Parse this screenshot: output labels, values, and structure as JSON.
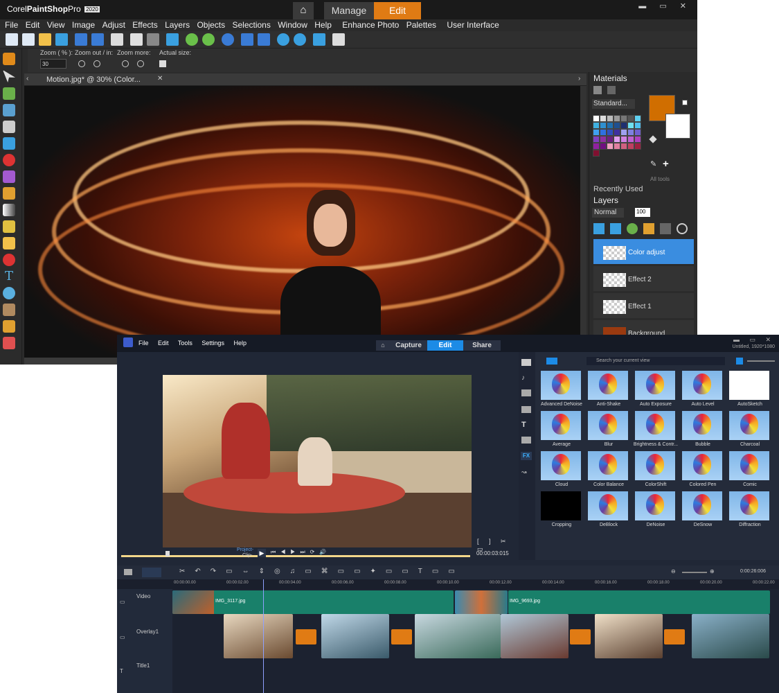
{
  "paintshop": {
    "brand_pre": "Corel",
    "brand_main": "PaintShop",
    "brand_post": "Pro",
    "version": "2020",
    "tabs": {
      "manage": "Manage",
      "edit": "Edit"
    },
    "menu": [
      "File",
      "Edit",
      "View",
      "Image",
      "Adjust",
      "Effects",
      "Layers",
      "Objects",
      "Selections",
      "Window",
      "Help",
      "Enhance Photo",
      "Palettes",
      "User Interface"
    ],
    "options": {
      "zoom_pct_label": "Zoom ( % ):",
      "zoom_inout_label": "Zoom out / in:",
      "zoom_more_label": "Zoom more:",
      "actual_size_label": "Actual size:",
      "zoom_value": "30"
    },
    "document_tab": "Motion.jpg* @ 30% (Color...",
    "materials": {
      "title": "Materials",
      "preset": "Standard...",
      "all_tools": "All tools",
      "primary_color": "#d06e00",
      "recent": "Recently Used"
    },
    "layers": {
      "title": "Layers",
      "blend": "Normal",
      "opacity": "100",
      "items": [
        "Color adjust",
        "Effect 2",
        "Effect 1",
        "Background"
      ]
    }
  },
  "videostudio": {
    "menu": [
      "File",
      "Edit",
      "Tools",
      "Settings",
      "Help"
    ],
    "tabs": {
      "capture": "Capture",
      "edit": "Edit",
      "share": "Share"
    },
    "project_info": "Untitled, 1920*1080",
    "player": {
      "project_label": "Project-",
      "clip_label": "Clip-",
      "timecode": "00:00:03:015"
    },
    "search_placeholder": "Search your current view",
    "effects": [
      "Advanced DeNoise",
      "Anti-Shake",
      "Auto Exposure",
      "Auto Level",
      "AutoSketch",
      "Average",
      "Blur",
      "Brightness & Contr...",
      "Bubble",
      "Charcoal",
      "Cloud",
      "Color Balance",
      "ColorShift",
      "Colored Pen",
      "Comic",
      "Cropping",
      "DeBlock",
      "DeNoise",
      "DeSnow",
      "Diffraction"
    ],
    "timeline": {
      "zoom_timecode": "0:00:26:006",
      "ruler": [
        "00:00:00.00",
        "00:00:02.00",
        "00:00:04.00",
        "00:00:06.00",
        "00:00:08.00",
        "00:00:10.00",
        "00:00:12.00",
        "00:00:14.00",
        "00:00:16.00",
        "00:00:18.00",
        "00:00:20.00",
        "00:00:22.00"
      ],
      "tracks": [
        "Video",
        "Overlay1",
        "Title1"
      ],
      "clips": {
        "clip1": "IMG_3117.jpg",
        "clip2": "IMG_9693.jpg"
      }
    }
  }
}
